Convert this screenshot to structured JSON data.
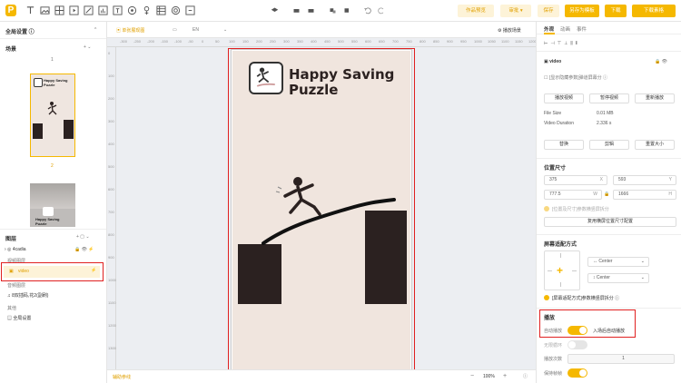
{
  "topbar": {
    "tools": [
      "text-icon",
      "image-icon",
      "grid-icon",
      "video-icon",
      "shape-icon",
      "chart-icon",
      "font-icon",
      "palette-icon",
      "effect-icon",
      "table-icon",
      "at-icon",
      "frame-icon"
    ],
    "center_tools": [
      "layers-icon",
      "align-icon",
      "distribute-icon",
      "group-icon",
      "copy-icon",
      "undo-icon",
      "redo-icon"
    ],
    "works_preview": "作品预览",
    "review": "审批",
    "save": "保存",
    "save_as_template": "另存为模板",
    "download": "下载",
    "download_format": "下载素格"
  },
  "left": {
    "global_settings": "全局设置",
    "scenes_title": "场景",
    "scene1_number": "1",
    "scene2_number": "2",
    "layers_title": "图层",
    "layer_root": "4cadia",
    "group_video": "视频图层",
    "video_layer": "video",
    "group_audio": "音频图层",
    "audio_layer": "8双插码,花2(副刷)",
    "group_other": "其他",
    "global_setting_item": "全局设置"
  },
  "canvas": {
    "toolbar_mode": "单张展现图",
    "lang": "EN",
    "play_scene": "播放场景",
    "ruler_top": [
      "-300",
      "-250",
      "-200",
      "-150",
      "-100",
      "-50",
      "0",
      "50",
      "100",
      "150",
      "200",
      "250",
      "300",
      "350",
      "400",
      "450",
      "500",
      "550",
      "600",
      "650",
      "700",
      "750",
      "800",
      "850",
      "900",
      "950",
      "1000",
      "1050",
      "1100",
      "1150",
      "1200",
      "1250"
    ],
    "ruler_left": [
      "0",
      "100",
      "200",
      "300",
      "400",
      "500",
      "600",
      "700",
      "800",
      "900",
      "1000",
      "1100",
      "1200",
      "1300"
    ],
    "game_title_line1": "Happy Saving",
    "game_title_line2": "Puzzle",
    "bottom_left": "辅助参线",
    "zoom": "100%",
    "zoom_minus": "−",
    "zoom_plus": "+"
  },
  "right": {
    "tabs": [
      "外观",
      "动画",
      "事件"
    ],
    "layer_name": "video",
    "show_hidden": "[显示隐藏参数]弹道屏幕分",
    "btn_play": "播放视频",
    "btn_pause": "暂停视频",
    "btn_replay": "重新播放",
    "file_size_label": "File Size",
    "file_size_value": "0.01 MB",
    "duration_label": "Video Duration",
    "duration_value": "2.336 s",
    "btn_replace": "替换",
    "btn_crop": "剪辑",
    "btn_resize": "重置大小",
    "position_title": "位置尺寸",
    "x_value": "375",
    "x_label": "X",
    "y_value": "593",
    "y_label": "Y",
    "w_value": "777.5",
    "w_label": "W",
    "h_value": "1666",
    "h_label": "H",
    "pos_hint": "[位置及尺寸]参数横竖屏拆分",
    "reuse_btn": "复用横屏位置尺寸配置",
    "fit_title": "屏幕适配方式",
    "center_h": "Center",
    "center_v": "Center",
    "fit_hint": "[屏幕适配方式]参数横竖屏拆分",
    "play_title": "播放",
    "autoplay_label": "自动播放",
    "autoplay_hint": "入场后自动播放",
    "loop_label": "无限循环",
    "times_label": "播放次数",
    "times_value": "1",
    "keep_frame_label": "保持帧帧"
  }
}
